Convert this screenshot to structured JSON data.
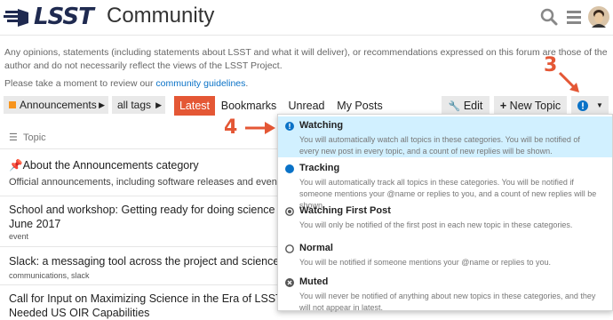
{
  "header": {
    "logo_text": "LSST",
    "site_title": "Community",
    "icons": [
      "search-icon",
      "hamburger-menu-icon",
      "user-avatar"
    ]
  },
  "disclaimer": "Any opinions, statements (including statements about LSST and what it will deliver), or recommendations expressed on this forum are those of the author and do not necessarily reflect the views of the LSST Project.",
  "review": {
    "prefix": "Please take a moment to review our ",
    "link": "community guidelines",
    "suffix": "."
  },
  "nav": {
    "category": "Announcements",
    "tags": "all tags",
    "tabs": [
      "Latest",
      "Bookmarks",
      "Unread",
      "My Posts"
    ],
    "active_tab": "Latest",
    "edit_label": "Edit",
    "new_topic_label": "New Topic",
    "notification_icon": "notification-bell-icon"
  },
  "annotations": {
    "three": "3",
    "four": "4"
  },
  "topics": {
    "header": "Topic",
    "rows": [
      {
        "title": "About the Announcements category",
        "excerpt": "Official announcements, including software releases and events.",
        "pinned": true
      },
      {
        "title": "School and workshop: Getting ready for doing science with LS",
        "title2": "June 2017",
        "tags": "event"
      },
      {
        "title": "Slack: a messaging tool across the project and science collabo",
        "tags": "communications, slack"
      },
      {
        "title": "Call for Input on Maximizing Science in the Era of LSST: A Com",
        "title2": "Needed US OIR Capabilities"
      }
    ]
  },
  "dropdown": {
    "items": [
      {
        "title": "Watching",
        "desc": "You will automatically watch all topics in these categories. You will be notified of every new post in every topic, and a count of new replies will be shown.",
        "icon": "exclamation-circle-icon",
        "selected": true
      },
      {
        "title": "Tracking",
        "desc": "You will automatically track all topics in these categories. You will be notified if someone mentions your @name or replies to you, and a count of new replies will be shown.",
        "icon": "filled-circle-icon"
      },
      {
        "title": "Watching First Post",
        "desc": "You will only be notified of the first post in each new topic in these categories.",
        "icon": "dot-circle-icon"
      },
      {
        "title": "Normal",
        "desc": "You will be notified if someone mentions your @name or replies to you.",
        "icon": "empty-circle-icon"
      },
      {
        "title": "Muted",
        "desc": "You will never be notified of anything about new topics in these categories, and they will not appear in latest.",
        "icon": "times-circle-icon"
      }
    ]
  },
  "colors": {
    "accent": "#e45735",
    "link": "#0a72c7",
    "selected_bg": "#d1f0ff",
    "notification_blue": "#0a72c7"
  }
}
